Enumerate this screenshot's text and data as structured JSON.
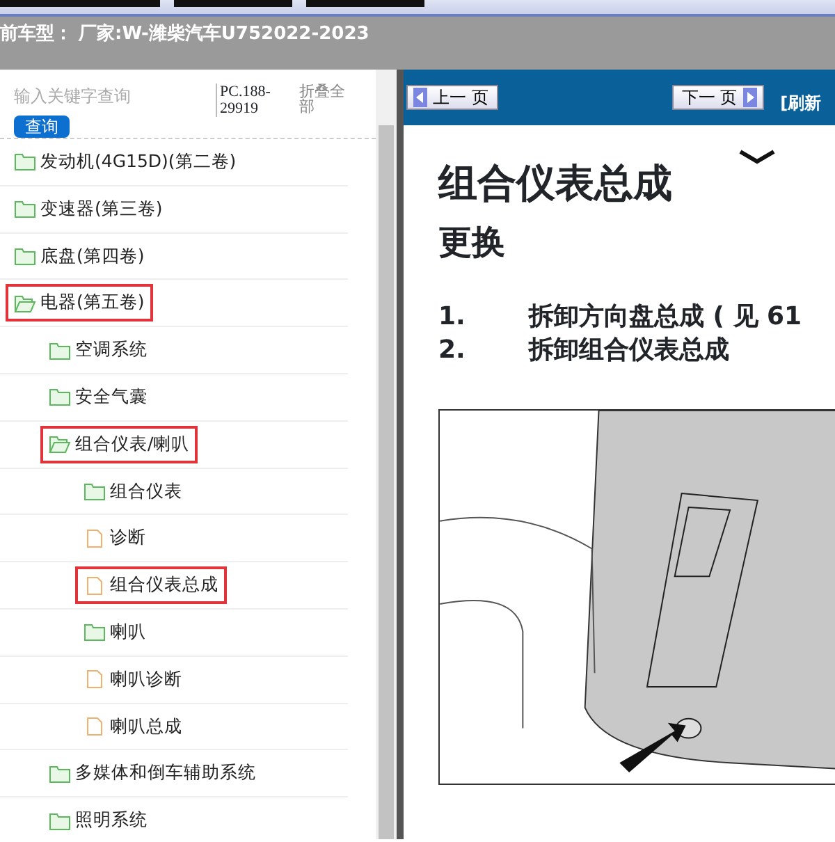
{
  "header": {
    "title": "前车型：  厂家:W-潍柴汽车U752022-2023"
  },
  "sidebar": {
    "search": {
      "placeholder": "输入关键字查询"
    },
    "search_button": "查询",
    "code": "PC.188-29919",
    "collapse_all": "折叠全部",
    "tree": [
      {
        "label": "发动机(4G15D)(第二卷)",
        "kind": "folder",
        "expanded": false,
        "highlighted": false
      },
      {
        "label": "变速器(第三卷)",
        "kind": "folder",
        "expanded": false,
        "highlighted": false
      },
      {
        "label": "底盘(第四卷)",
        "kind": "folder",
        "expanded": false,
        "highlighted": false
      },
      {
        "label": "电器(第五卷)",
        "kind": "folder",
        "expanded": true,
        "highlighted": true,
        "children": [
          {
            "label": "空调系统",
            "kind": "folder",
            "expanded": false,
            "highlighted": false
          },
          {
            "label": "安全气囊",
            "kind": "folder",
            "expanded": false,
            "highlighted": false
          },
          {
            "label": "组合仪表/喇叭",
            "kind": "folder",
            "expanded": true,
            "highlighted": true,
            "children": [
              {
                "label": "组合仪表",
                "kind": "folder",
                "expanded": false,
                "highlighted": false
              },
              {
                "label": "诊断",
                "kind": "document",
                "highlighted": false
              },
              {
                "label": "组合仪表总成",
                "kind": "document",
                "highlighted": true
              },
              {
                "label": "喇叭",
                "kind": "folder",
                "expanded": false,
                "highlighted": false
              },
              {
                "label": "喇叭诊断",
                "kind": "document",
                "highlighted": false
              },
              {
                "label": "喇叭总成",
                "kind": "document",
                "highlighted": false
              }
            ]
          },
          {
            "label": "多媒体和倒车辅助系统",
            "kind": "folder",
            "expanded": false,
            "highlighted": false
          },
          {
            "label": "照明系统",
            "kind": "folder",
            "expanded": false,
            "highlighted": false
          }
        ]
      }
    ]
  },
  "toolbar": {
    "prev_button": "上一 页",
    "next_button": "下一 页",
    "refresh": "[刷新"
  },
  "document": {
    "title": "组合仪表总成",
    "subtitle": "更换",
    "steps": [
      {
        "number": "1.",
        "text": "拆卸方向盘总成 ( 见 61"
      },
      {
        "number": "2.",
        "text": "拆卸组合仪表总成"
      }
    ]
  }
}
